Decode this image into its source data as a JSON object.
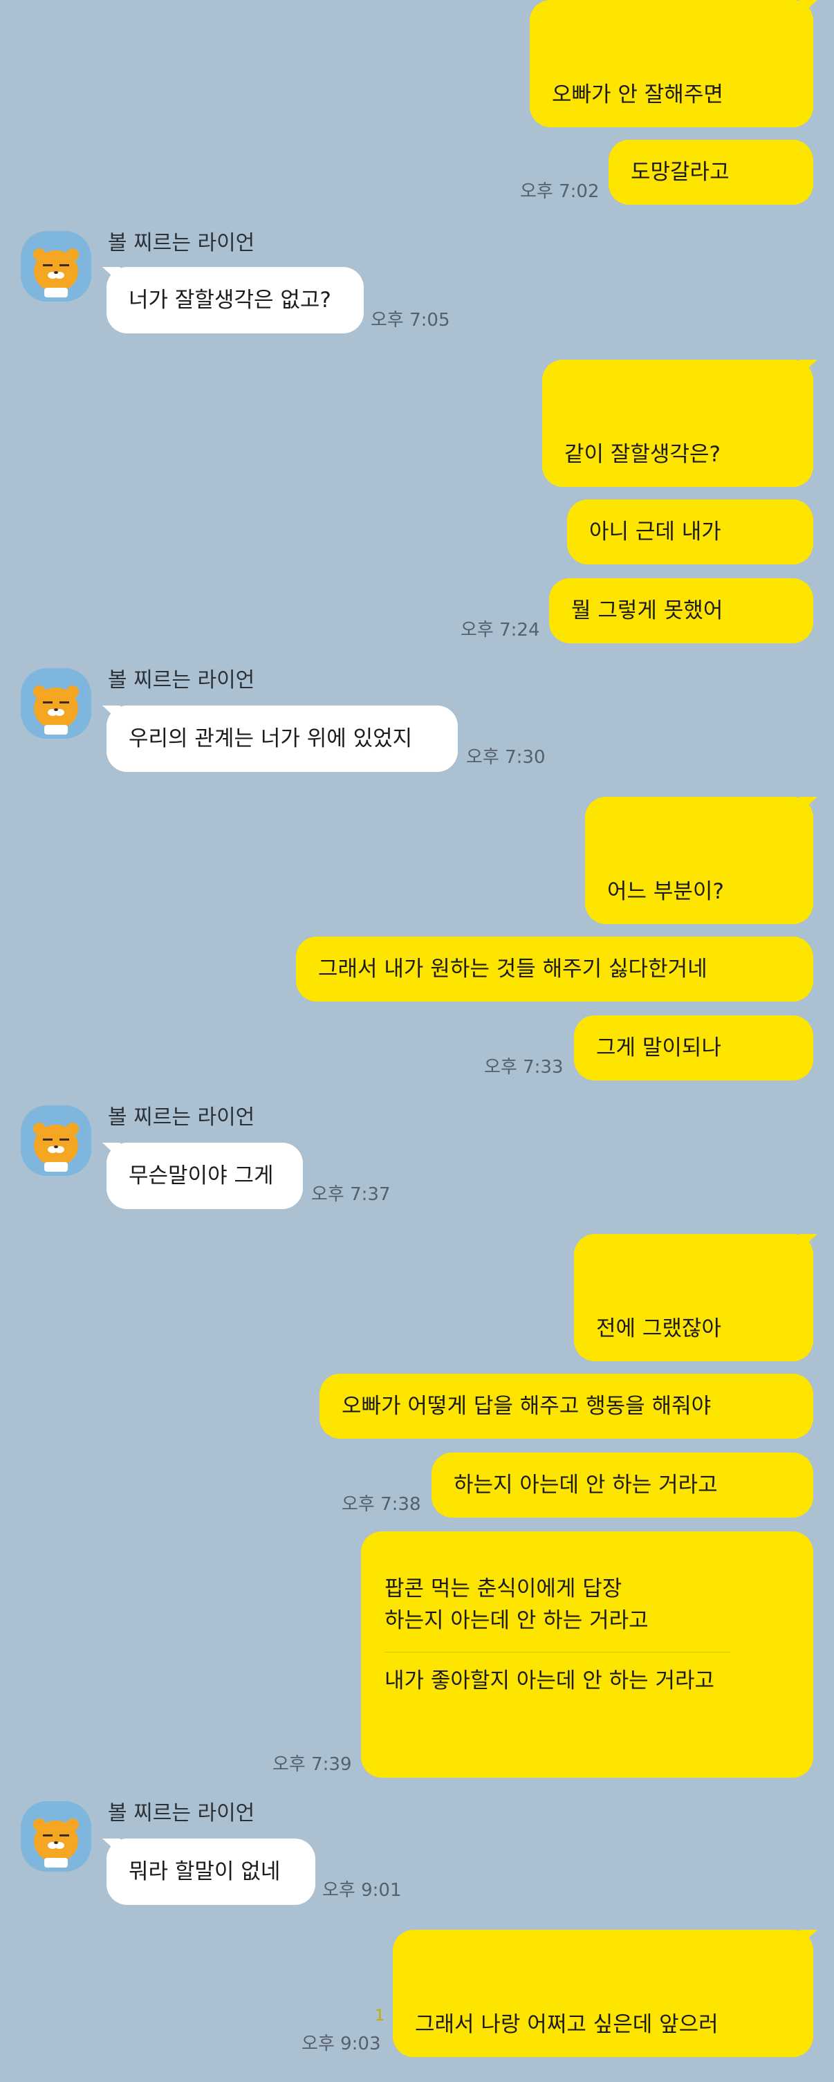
{
  "contact": {
    "name": "볼 찌르는 라이언",
    "avatar_icon": "ryan-character-icon"
  },
  "messages": [
    {
      "from": "me",
      "text": "오빠가 안 잘해주면"
    },
    {
      "from": "me",
      "text": "도망갈라고",
      "time": "오후 7:02"
    },
    {
      "from": "them",
      "sender": "볼 찌르는 라이언",
      "text": "너가 잘할생각은 없고?",
      "time": "오후 7:05"
    },
    {
      "from": "me",
      "text": "같이 잘할생각은?"
    },
    {
      "from": "me",
      "text": "아니 근데 내가"
    },
    {
      "from": "me",
      "text": "뭘 그렇게 못했어",
      "time": "오후 7:24"
    },
    {
      "from": "them",
      "sender": "볼 찌르는 라이언",
      "text": "우리의 관계는 너가 위에 있었지",
      "time": "오후 7:30"
    },
    {
      "from": "me",
      "text": "어느 부분이?"
    },
    {
      "from": "me",
      "text": "그래서 내가 원하는 것들 해주기 싫다한거네"
    },
    {
      "from": "me",
      "text": "그게 말이되나",
      "time": "오후 7:33"
    },
    {
      "from": "them",
      "sender": "볼 찌르는 라이언",
      "text": "무슨말이야 그게",
      "time": "오후 7:37"
    },
    {
      "from": "me",
      "text": "전에 그랬잖아"
    },
    {
      "from": "me",
      "text": "오빠가 어떻게 답을 해주고 행동을 해줘야"
    },
    {
      "from": "me",
      "text": "하는지 아는데 안 하는 거라고",
      "time": "오후 7:38"
    },
    {
      "from": "me",
      "reply_to": "팝콘 먹는 춘식이에게 답장",
      "quoted": "하는지 아는데 안 하는 거라고",
      "text": "내가 좋아할지 아는데 안 하는 거라고",
      "time": "오후 7:39"
    },
    {
      "from": "them",
      "sender": "볼 찌르는 라이언",
      "text": "뭐라 할말이 없네",
      "time": "오후 9:01"
    },
    {
      "from": "me",
      "text": "그래서 나랑 어쩌고 싶은데 앞으러",
      "time": "오후 9:03",
      "unread": "1"
    }
  ],
  "colors": {
    "background": "#abc1d1",
    "my_bubble": "#fee500",
    "their_bubble": "#ffffff",
    "avatar_bg": "#7fb6de",
    "ryan_face": "#f5a623"
  }
}
